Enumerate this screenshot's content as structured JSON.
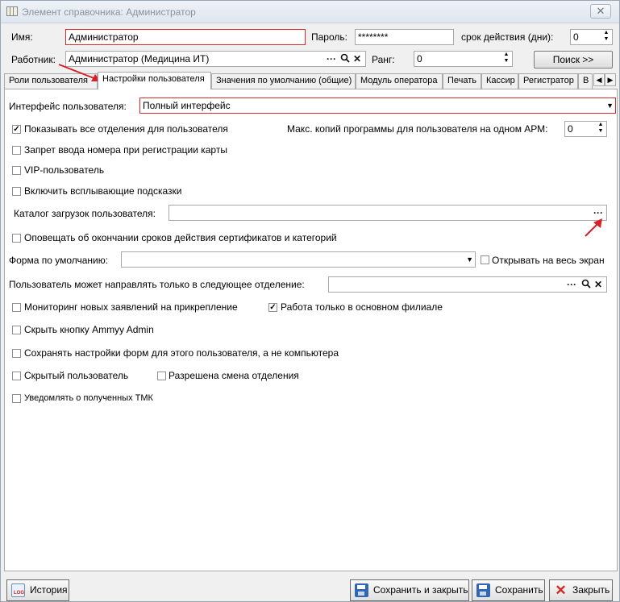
{
  "window": {
    "title": "Элемент справочника: Администратор",
    "close_glyph": "✕"
  },
  "header": {
    "name_label": "Имя:",
    "name_value": "Администратор",
    "password_label": "Пароль:",
    "password_value": "********",
    "validity_label": "срок действия (дни):",
    "validity_value": "0",
    "worker_label": "Работник:",
    "worker_value": "Администратор (Медицина ИТ)",
    "rank_label": "Ранг:",
    "rank_value": "0",
    "search_button": "Поиск >>"
  },
  "tabs": [
    {
      "label": "Роли пользователя"
    },
    {
      "label": "Настройки пользователя"
    },
    {
      "label": "Значения по умолчанию (общие)"
    },
    {
      "label": "Модуль оператора"
    },
    {
      "label": "Печать"
    },
    {
      "label": "Кассир"
    },
    {
      "label": "Регистратор"
    },
    {
      "label": "В"
    }
  ],
  "settings": {
    "ui_label": "Интерфейс пользователя:",
    "ui_value": "Полный интерфейс",
    "show_all_departments": "Показывать все отделения для пользователя",
    "max_copies_label": "Макс. копий программы для пользователя на одном АРМ:",
    "max_copies_value": "0",
    "ban_card_number": "Запрет ввода номера при регистрации карты",
    "vip_user": "VIP-пользователь",
    "tooltips": "Включить всплывающие подсказки",
    "download_dir_label": "Каталог загрузок пользователя:",
    "download_dir_value": "",
    "notify_certs": "Оповещать об окончании сроков действия сертификатов и категорий",
    "default_form_label": "Форма по умолчанию:",
    "default_form_value": "",
    "open_fullscreen": "Открывать на весь экран",
    "only_department_label": "Пользователь может направлять только в следующее отделение:",
    "only_department_value": "",
    "monitoring": "Мониторинг новых заявлений на прикрепление",
    "main_branch_only": "Работа только в основном филиале",
    "hide_ammyy": "Скрыть кнопку Ammyy Admin",
    "save_form_settings": "Сохранять настройки форм для этого пользователя, а не компьютера",
    "hidden_user": "Скрытый пользователь",
    "allow_dept_change": "Разрешена смена отделения",
    "notify_tmk": "Уведомлять о полученных ТМК"
  },
  "footer": {
    "history": "История",
    "save_close": "Сохранить и закрыть",
    "save": "Сохранить",
    "close": "Закрыть"
  },
  "colors": {
    "highlight_border": "#d8292f",
    "annotation_arrow": "#d8202a"
  }
}
